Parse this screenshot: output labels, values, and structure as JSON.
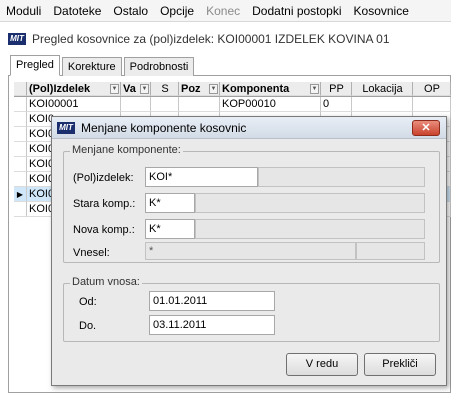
{
  "menubar": {
    "items": [
      "Moduli",
      "Datoteke",
      "Ostalo",
      "Opcije",
      "Konec",
      "Dodatni postopki",
      "Kosovnice"
    ],
    "disabled": [
      false,
      false,
      false,
      false,
      true,
      false,
      false
    ]
  },
  "app_logo": "MIT",
  "window": {
    "title": "Pregled kosovnice za (pol)izdelek: KOI00001 IZDELEK KOVINA 01"
  },
  "tabs": [
    "Pregled",
    "Korekture",
    "Podrobnosti"
  ],
  "grid": {
    "headers": [
      "(Pol)Izdelek",
      "Va",
      "S",
      "Poz",
      "Komponenta",
      "PP",
      "Lokacija",
      "OP"
    ],
    "rows": [
      [
        "KOI00001",
        "",
        "",
        "",
        "KOP00010",
        "0",
        "",
        ""
      ],
      [
        "KOI0",
        "",
        "",
        "",
        "",
        "",
        "",
        ""
      ],
      [
        "KOI0",
        "",
        "",
        "",
        "",
        "",
        "",
        ""
      ],
      [
        "KOI0",
        "",
        "",
        "",
        "",
        "",
        "",
        ""
      ],
      [
        "KOI0",
        "",
        "",
        "",
        "",
        "",
        "",
        ""
      ],
      [
        "KOI0",
        "",
        "",
        "",
        "",
        "",
        "",
        ""
      ],
      [
        "KOI0",
        "",
        "",
        "",
        "",
        "",
        "",
        ""
      ],
      [
        "KOI0",
        "",
        "",
        "",
        "",
        "",
        "",
        ""
      ]
    ],
    "row_indicator": "▶",
    "selected_row": 6
  },
  "dialog": {
    "title": "Menjane komponente kosovnic",
    "close_glyph": "✕",
    "komponente": {
      "legend": "Menjane komponente:",
      "polizdelek_label": "(Pol)izdelek:",
      "polizdelek_value": "KOI*",
      "polizdelek_extra": "",
      "stara_label": "Stara komp.:",
      "stara_value": "K*",
      "stara_extra": "",
      "nova_label": "Nova komp.:",
      "nova_value": "K*",
      "nova_extra": "",
      "vnesel_label": "Vnesel:",
      "vnesel_value": "*",
      "vnesel_extra": ""
    },
    "datum": {
      "legend": "Datum vnosa:",
      "od_label": "Od:",
      "od_value": "01.01.2011",
      "do_label": "Do.",
      "do_value": "03.11.2011"
    },
    "ok_label": "V redu",
    "cancel_label": "Prekliči"
  }
}
